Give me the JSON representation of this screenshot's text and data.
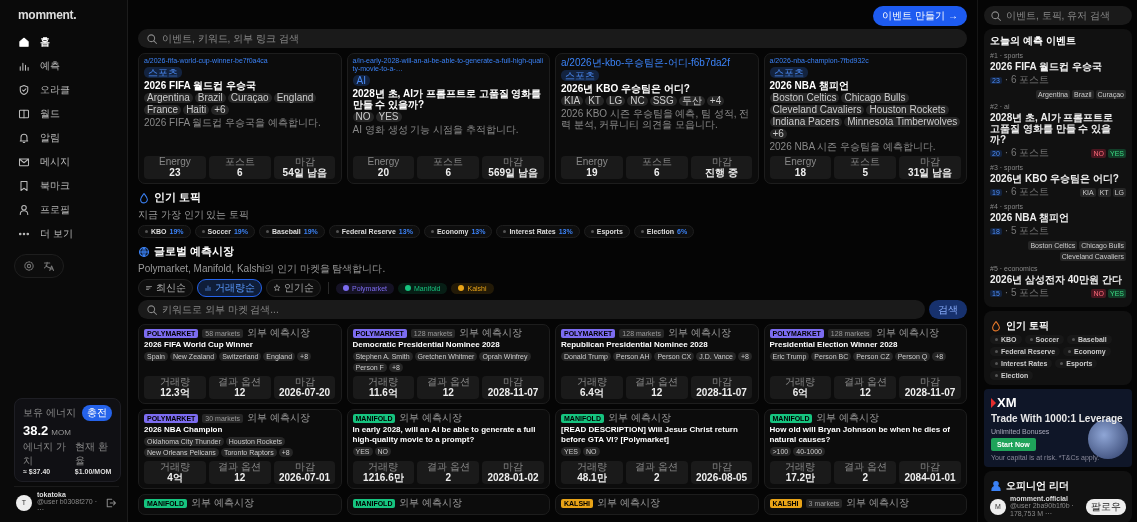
{
  "sidebar": {
    "logo": "momment.",
    "nav": [
      {
        "label": "홈",
        "selected": true
      },
      {
        "label": "예측",
        "selected": false
      },
      {
        "label": "오라클",
        "selected": false
      },
      {
        "label": "월드",
        "selected": false
      },
      {
        "label": "알림",
        "selected": false
      },
      {
        "label": "메시지",
        "selected": false
      },
      {
        "label": "북마크",
        "selected": false
      },
      {
        "label": "프로필",
        "selected": false
      },
      {
        "label": "더 보기",
        "selected": false
      }
    ],
    "balance": {
      "label": "보유 에너지",
      "badge": "충전",
      "amount": "38.2",
      "unit": "MOM",
      "stats": [
        {
          "label": "에너지 가치",
          "value": "≈ $37.40"
        },
        {
          "label": "현재 환율",
          "value": "$1.00/MOM"
        }
      ]
    },
    "user": {
      "avatar": "T",
      "name": "tokatoka",
      "handle": "@user b0308f270 · ···"
    }
  },
  "main": {
    "create_button": "이벤트 만들기 →",
    "search": {
      "placeholder": "이벤트, 키워드, 외부 링크 검색"
    },
    "events": [
      {
        "link": "a/2026-fifa-world-cup-winner-be7f0a4ca",
        "tag": "스포츠",
        "title": "2026 FIFA 월드컵 우승국",
        "chips": [
          "Argentina",
          "Brazil",
          "Curaçao",
          "England",
          "France",
          "Haiti",
          "+6"
        ],
        "description": "2026 FIFA 월드컵 우승국을 예측합니다.",
        "stats": [
          {
            "label": "Energy",
            "value": "23"
          },
          {
            "label": "포스트",
            "value": "6"
          },
          {
            "label": "마감",
            "value": "54일 남음"
          }
        ]
      },
      {
        "link": "a/in-early-2028-will-an-ai-be-able-to-generate-a-full-high-quality-movie-to-a-…",
        "tag": "AI",
        "title": "2028년 초, AI가 프롬프트로 고품질 영화를 만들 수 있을까?",
        "chips": [
          "NO",
          "YES"
        ],
        "description": "AI 영화 생성 기능 시점을 추적합니다.",
        "stats": [
          {
            "label": "Energy",
            "value": "20"
          },
          {
            "label": "포스트",
            "value": "6"
          },
          {
            "label": "마감",
            "value": "569일 남음"
          }
        ]
      },
      {
        "link": "a/2026년-kbo-우승팀은-어디-f6b7da2f",
        "tag": "스포츠",
        "title": "2026년 KBO 우승팀은 어디?",
        "chips": [
          "KIA",
          "KT",
          "LG",
          "NC",
          "SSG",
          "두산",
          "+4"
        ],
        "description": "2026 KBO 시즌 우승팀을 예측, 팀 성적, 전력 분석, 커뮤니티 의견을 모읍니다.",
        "stats": [
          {
            "label": "Energy",
            "value": "19"
          },
          {
            "label": "포스트",
            "value": "6"
          },
          {
            "label": "마감",
            "value": "진행 중"
          }
        ]
      },
      {
        "link": "a/2026-nba-champion-7fbd932c",
        "tag": "스포츠",
        "title": "2026 NBA 챔피언",
        "chips": [
          "Boston Celtics",
          "Chicago Bulls",
          "Cleveland Cavaliers",
          "Houston Rockets",
          "Indiana Pacers",
          "Minnesota Timberwolves",
          "+6"
        ],
        "description": "2026 NBA 시즌 우승팀을 예측합니다.",
        "stats": [
          {
            "label": "Energy",
            "value": "18"
          },
          {
            "label": "포스트",
            "value": "5"
          },
          {
            "label": "마감",
            "value": "31일 남음"
          }
        ]
      }
    ],
    "topics": {
      "title": "인기 토픽",
      "subtitle": "지금 가장 인기 있는 토픽",
      "items": [
        {
          "label": "KBO",
          "share": "19%"
        },
        {
          "label": "Soccer",
          "share": "19%"
        },
        {
          "label": "Baseball",
          "share": "19%"
        },
        {
          "label": "Federal Reserve",
          "share": "13%"
        },
        {
          "label": "Economy",
          "share": "13%"
        },
        {
          "label": "Interest Rates",
          "share": "13%"
        },
        {
          "label": "Esports"
        },
        {
          "label": "Election",
          "share": "6%"
        }
      ]
    },
    "markets": {
      "title": "글로벌 예측시장",
      "subtitle": "Polymarket, Manifold, Kalshi의 인기 마켓을 탐색합니다.",
      "sorts": [
        {
          "label": "최신순",
          "selected": false
        },
        {
          "label": "거래량순",
          "selected": true
        },
        {
          "label": "인기순",
          "selected": false
        }
      ],
      "sources": [
        {
          "label": "Polymarket",
          "color": "#7c6cf0"
        },
        {
          "label": "Manifold",
          "color": "#16c47f"
        },
        {
          "label": "Kalshi",
          "color": "#e8a317"
        }
      ],
      "search": {
        "placeholder": "키워드로 외부 마켓 검색..."
      },
      "search_button": "검색",
      "cards": [
        {
          "source": "POLYMARKET",
          "color": "#7c6cf0",
          "count": "58 markets",
          "label": "외부 예측시장",
          "title": "2026 FIFA World Cup Winner",
          "chips": [
            "Spain",
            "New Zealand",
            "Switzerland",
            "England",
            "+8"
          ],
          "stats": [
            {
              "label": "거래량",
              "value": "12.3억"
            },
            {
              "label": "결과 옵션",
              "value": "12"
            },
            {
              "label": "마감",
              "value": "2026-07-20"
            }
          ]
        },
        {
          "source": "POLYMARKET",
          "color": "#7c6cf0",
          "count": "128 markets",
          "label": "외부 예측시장",
          "title": "Democratic Presidential Nominee 2028",
          "chips": [
            "Stephen A. Smith",
            "Gretchen Whitmer",
            "Oprah Winfrey",
            "Person F",
            "+8"
          ],
          "stats": [
            {
              "label": "거래량",
              "value": "11.6억"
            },
            {
              "label": "결과 옵션",
              "value": "12"
            },
            {
              "label": "마감",
              "value": "2028-11-07"
            }
          ]
        },
        {
          "source": "POLYMARKET",
          "color": "#7c6cf0",
          "count": "128 markets",
          "label": "외부 예측시장",
          "title": "Republican Presidential Nominee 2028",
          "chips": [
            "Donald Trump",
            "Person AH",
            "Person CX",
            "J.D. Vance",
            "+8"
          ],
          "stats": [
            {
              "label": "거래량",
              "value": "6.4억"
            },
            {
              "label": "결과 옵션",
              "value": "12"
            },
            {
              "label": "마감",
              "value": "2028-11-07"
            }
          ]
        },
        {
          "source": "POLYMARKET",
          "color": "#7c6cf0",
          "count": "128 markets",
          "label": "외부 예측시장",
          "title": "Presidential Election Winner 2028",
          "chips": [
            "Eric Trump",
            "Person BC",
            "Person CZ",
            "Person Q",
            "+8"
          ],
          "stats": [
            {
              "label": "거래량",
              "value": "6억"
            },
            {
              "label": "결과 옵션",
              "value": "12"
            },
            {
              "label": "마감",
              "value": "2028-11-07"
            }
          ]
        },
        {
          "source": "POLYMARKET",
          "color": "#7c6cf0",
          "count": "30 markets",
          "label": "외부 예측시장",
          "title": "2026 NBA Champion",
          "chips": [
            "Oklahoma City Thunder",
            "Houston Rockets",
            "New Orleans Pelicans",
            "Toronto Raptors",
            "+8"
          ],
          "stats": [
            {
              "label": "거래량",
              "value": "4억"
            },
            {
              "label": "결과 옵션",
              "value": "12"
            },
            {
              "label": "마감",
              "value": "2026-07-01"
            }
          ]
        },
        {
          "source": "MANIFOLD",
          "color": "#16c47f",
          "label": "외부 예측시장",
          "title": "In early 2028, will an AI be able to generate a full high-quality movie to a prompt?",
          "chips": [
            "YES",
            "NO"
          ],
          "stats": [
            {
              "label": "거래량",
              "value": "1216.6만"
            },
            {
              "label": "결과 옵션",
              "value": "2"
            },
            {
              "label": "마감",
              "value": "2028-01-02"
            }
          ]
        },
        {
          "source": "MANIFOLD",
          "color": "#16c47f",
          "label": "외부 예측시장",
          "title": "[READ DESCRIPTION] Will Jesus Christ return before GTA VI? [Polymarket]",
          "chips": [
            "YES",
            "NO"
          ],
          "stats": [
            {
              "label": "거래량",
              "value": "48.1만"
            },
            {
              "label": "결과 옵션",
              "value": "2"
            },
            {
              "label": "마감",
              "value": "2026-08-05"
            }
          ]
        },
        {
          "source": "MANIFOLD",
          "color": "#16c47f",
          "label": "외부 예측시장",
          "title": "How old will Bryan Johnson be when he dies of natural causes?",
          "chips": [
            ">100",
            "40-1000"
          ],
          "stats": [
            {
              "label": "거래량",
              "value": "17.2만"
            },
            {
              "label": "결과 옵션",
              "value": "2"
            },
            {
              "label": "마감",
              "value": "2084-01-01"
            }
          ]
        },
        {
          "source": "MANIFOLD",
          "color": "#16c47f",
          "label": "외부 예측시장"
        },
        {
          "source": "MANIFOLD",
          "color": "#16c47f",
          "label": "외부 예측시장"
        },
        {
          "source": "KALSHI",
          "color": "#e8a317",
          "label": "외부 예측시장"
        },
        {
          "source": "KALSHI",
          "color": "#e8a317",
          "count": "3 markets",
          "label": "외부 예측시장"
        }
      ]
    }
  },
  "right": {
    "search": {
      "placeholder": "이벤트, 토픽, 유저 검색"
    },
    "today": {
      "title": "오늘의 예측 이벤트",
      "items": [
        {
          "rank": "#1 · sports",
          "title": "2026 FIFA 월드컵 우승국",
          "energy": "23",
          "posts": "· 6 포스트",
          "chips": [
            {
              "kind": "plain",
              "label": "Argentina"
            },
            {
              "kind": "plain",
              "label": "Brazil"
            },
            {
              "kind": "plain",
              "label": "Curaçao"
            }
          ]
        },
        {
          "rank": "#2 · ai",
          "title": "2028년 초, AI가 프롬프트로 고품질 영화를 만들 수 있을까?",
          "energy": "20",
          "posts": "· 6 포스트",
          "chips": [
            {
              "kind": "no",
              "label": "NO"
            },
            {
              "kind": "yes",
              "label": "YES"
            }
          ]
        },
        {
          "rank": "#3 · sports",
          "title": "2026년 KBO 우승팀은 어디?",
          "energy": "19",
          "posts": "· 6 포스트",
          "chips": [
            {
              "kind": "plain",
              "label": "KIA"
            },
            {
              "kind": "plain",
              "label": "KT"
            },
            {
              "kind": "plain",
              "label": "LG"
            }
          ]
        },
        {
          "rank": "#4 · sports",
          "title": "2026 NBA 챔피언",
          "energy": "18",
          "posts": "· 5 포스트",
          "chips": [
            {
              "kind": "plain",
              "label": "Boston Celtics"
            },
            {
              "kind": "plain",
              "label": "Chicago Bulls"
            },
            {
              "kind": "plain",
              "label": "Cleveland Cavaliers"
            }
          ]
        },
        {
          "rank": "#5 · economics",
          "title": "2026년 삼성전자 40만원 간다",
          "energy": "15",
          "posts": "· 5 포스트",
          "chips": [
            {
              "kind": "no",
              "label": "NO"
            },
            {
              "kind": "yes",
              "label": "YES"
            }
          ]
        }
      ]
    },
    "topics": {
      "title": "인기 토픽",
      "items": [
        "KBO",
        "Soccer",
        "Baseball",
        "Federal Reserve",
        "Economy",
        "Interest Rates",
        "Esports",
        "Election"
      ]
    },
    "ad": {
      "logo": "XM",
      "headline": "Trade With 1000:1 Leverage",
      "feature": "Unlimited Bonuses",
      "button": "Start Now",
      "disclaimer": "Your capital is at risk. *T&Cs apply."
    },
    "leaders": {
      "title": "오피니언 리더",
      "items": [
        {
          "avatar": "M",
          "name": "momment.official",
          "meta": "@user 2ba90b1f0b · 178,753 M ···",
          "button": "팔로우"
        }
      ]
    }
  }
}
